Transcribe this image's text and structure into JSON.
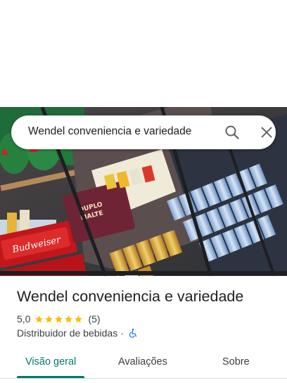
{
  "search": {
    "query": "Wendel conveniencia e variedade"
  },
  "place": {
    "name": "Wendel conveniencia e variedade",
    "rating": "5,0",
    "stars": 5,
    "reviews": "(5)",
    "category": "Distribuidor de bebidas",
    "separator": "·"
  },
  "tabs": [
    {
      "label": "Visão geral",
      "active": true
    },
    {
      "label": "Avaliações",
      "active": false
    },
    {
      "label": "Sobre",
      "active": false
    }
  ],
  "photo": {
    "description_icons": [
      "beer-fridge",
      "beer-cans",
      "beer-crates"
    ],
    "crate_brand": "Budweiser",
    "pack_label": "DUPLO MALTE"
  },
  "colors": {
    "accent": "#00796b",
    "star": "#fbbc04",
    "wheelchair": "#1a73e8"
  },
  "icons": {
    "search": "search-icon",
    "close": "close-icon",
    "accessibility": "wheelchair-icon",
    "star": "star-icon"
  }
}
